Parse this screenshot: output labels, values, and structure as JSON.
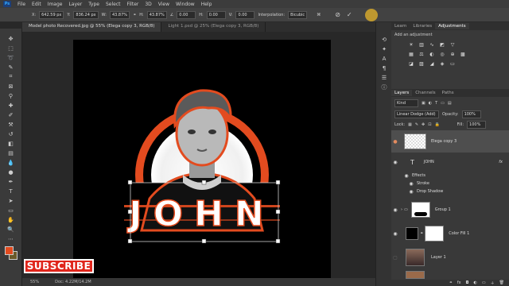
{
  "menu": {
    "items": [
      "File",
      "Edit",
      "Image",
      "Layer",
      "Type",
      "Select",
      "Filter",
      "3D",
      "View",
      "Window",
      "Help"
    ]
  },
  "options": {
    "x_label": "X:",
    "x_value": "642.59 px",
    "y_label": "Y:",
    "y_value": "836.24 px",
    "w_label": "W:",
    "w_value": "43.87%",
    "h_label": "H:",
    "h_value": "43.87%",
    "angle_value": "0.00",
    "h_skew_label": "H:",
    "h_skew_value": "0.00",
    "v_skew_label": "V:",
    "v_skew_value": "0.00",
    "interp_label": "Interpolation:",
    "interp_value": "Bicubic"
  },
  "tabs": [
    {
      "label": "Model photo Recovered.jpg @ 55% (Elega copy 3, RGB/8)"
    },
    {
      "label": "Light 1.psd @ 25% (Elega copy 3, RGB/8)"
    }
  ],
  "artwork": {
    "name_text": "JOHN",
    "subscribe": "SUBSCRIBE"
  },
  "status": {
    "zoom": "55%",
    "doc": "Doc: 4.22M/14.2M"
  },
  "panel": {
    "top_tabs": [
      "Learn",
      "Libraries",
      "Adjustments"
    ],
    "add_adjustment": "Add an adjustment",
    "layers_tabs": [
      "Layers",
      "Channels",
      "Paths"
    ],
    "kind": "Kind",
    "blend_mode": "Linear Dodge (Add)",
    "opacity_label": "Opacity:",
    "opacity_value": "100%",
    "lock_label": "Lock:",
    "fill_label": "Fill:",
    "fill_value": "100%"
  },
  "layers": [
    {
      "name": "Elega copy 3"
    },
    {
      "name": "JOHN",
      "fx": "fx"
    },
    {
      "name": "Effects"
    },
    {
      "name": "Stroke"
    },
    {
      "name": "Drop Shadow"
    },
    {
      "name": "Group 1"
    },
    {
      "name": "Color Fill 1"
    },
    {
      "name": "Layer 1"
    }
  ],
  "colors": {
    "accent": "#e34b1f",
    "selected_row": "#4e4e4e",
    "fg": "#e34b1f",
    "bg": "#6a5a2a"
  }
}
